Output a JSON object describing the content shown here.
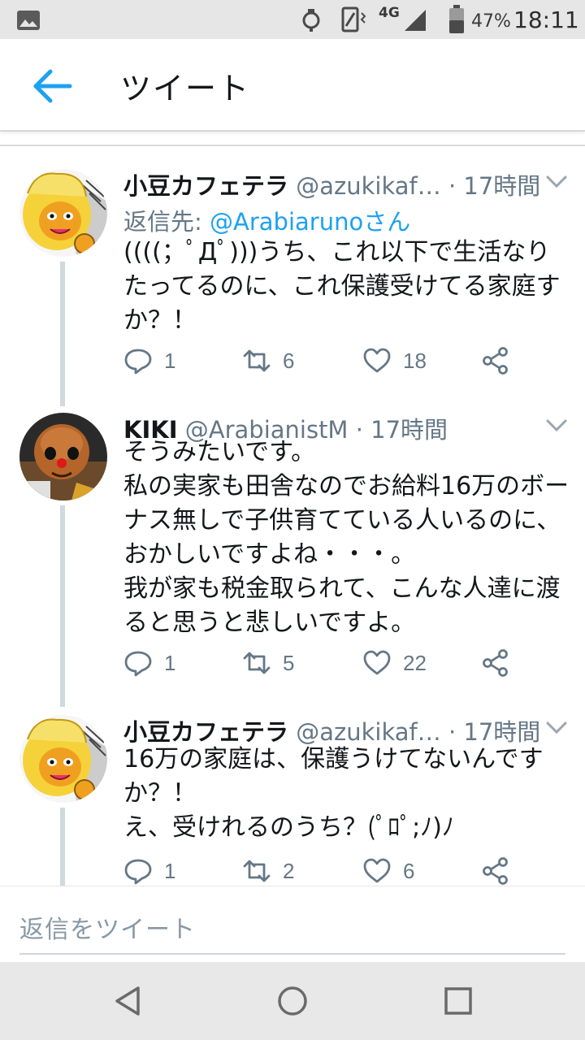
{
  "status_bar": {
    "network": "4G",
    "battery": "47%",
    "time": "18:11"
  },
  "app_bar": {
    "title": "ツイート"
  },
  "tweets": [
    {
      "name": "小豆カフェテラ",
      "handle": "@azukikaf…",
      "time": "· 17時間",
      "reply_to_label": "返信先:",
      "reply_to_user": "@Arabiaruno",
      "reply_to_suffix": "さん",
      "text": "((((；ﾟДﾟ)))うち、これ以下で生活なり\nたってるのに、これ保護受けてる家庭す\nか？！",
      "replies": "1",
      "retweets": "6",
      "likes": "18"
    },
    {
      "name": "KIKI",
      "handle": "@ArabianistM",
      "time": "· 17時間",
      "text": "そうみたいです。\n私の実家も田舎なのでお給料16万のボー\nナス無しで子供育てている人いるのに、\nおかしいですよね・・・。\n我が家も税金取られて、こんな人達に渡\nると思うと悲しいですよ。",
      "replies": "1",
      "retweets": "5",
      "likes": "22"
    },
    {
      "name": "小豆カフェテラ",
      "handle": "@azukikaf…",
      "time": "· 17時間",
      "text": "16万の家庭は、保護うけてないんです\nか？！\nえ、受けれるのうち？(ﾟﾛﾟ;ﾉ)ﾉ",
      "replies": "1",
      "retweets": "2",
      "likes": "6"
    }
  ],
  "compose": {
    "placeholder": "返信をツイート"
  },
  "colors": {
    "accent": "#1da1f2",
    "secondary_text": "#657786",
    "thread_line": "#cfd9de"
  },
  "icons": [
    "image-icon",
    "alarm-icon",
    "vibrate-icon",
    "signal-icon",
    "battery-icon",
    "back-arrow-icon",
    "chevron-down-icon",
    "reply-icon",
    "retweet-icon",
    "like-icon",
    "share-icon",
    "nav-back-icon",
    "nav-home-icon",
    "nav-recents-icon"
  ]
}
